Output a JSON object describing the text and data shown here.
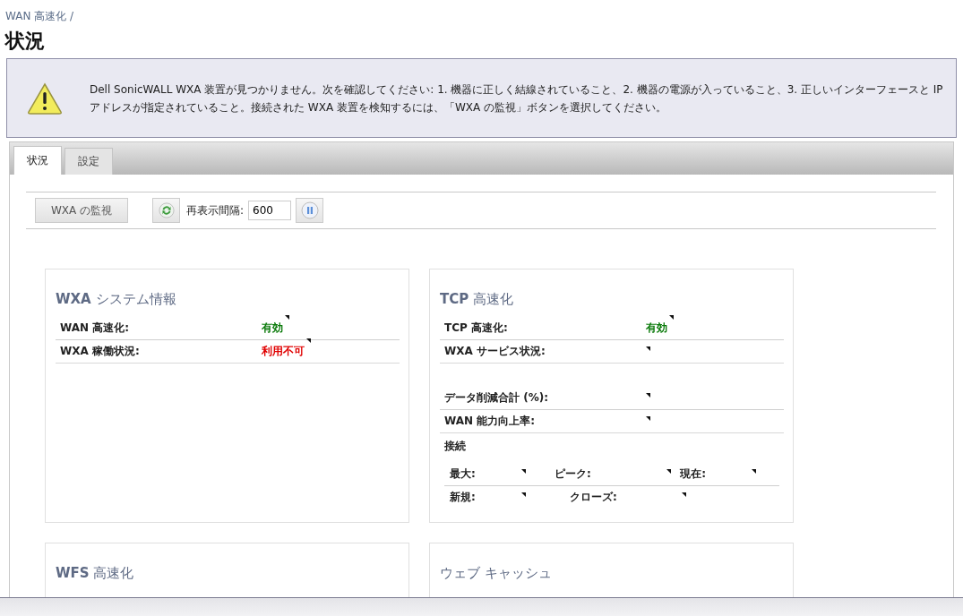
{
  "breadcrumb": "WAN 高速化 /",
  "page_title": "状況",
  "notice": {
    "text": "Dell SonicWALL WXA 装置が見つかりません。次を確認してください: 1. 機器に正しく結線されていること、2. 機器の電源が入っていること、3. 正しいインターフェースと IP アドレスが指定されていること。接続された WXA 装置を検知するには、「WXA の監視」ボタンを選択してください。"
  },
  "tabs": [
    {
      "label": "状況",
      "selected": true
    },
    {
      "label": "設定",
      "selected": false
    }
  ],
  "toolbar": {
    "monitor_button": "WXA の監視",
    "refresh_label": "再表示間隔:",
    "refresh_value": "600"
  },
  "panels": [
    {
      "title": "**WXA** システム情報",
      "groups": [
        [
          {
            "label": "WAN 高速化:",
            "value": "有効",
            "color": "#0a7a0a"
          },
          {
            "label": "WXA 稼働状況:",
            "value": "利用不可",
            "color": "#e00000"
          }
        ]
      ]
    },
    {
      "title": "**TCP** 高速化",
      "groups": [
        [
          {
            "label": "TCP 高速化:",
            "value": "有効",
            "color": "#0a7a0a"
          },
          {
            "label": "WXA サービス状況:"
          }
        ],
        [
          {
            "label": "データ削減合計 (%):"
          },
          {
            "label": "WAN 能力向上率:"
          }
        ]
      ],
      "connections": {
        "title": "接続",
        "rows": [
          [
            {
              "label": "最大:"
            },
            {
              "label": "ピーク:"
            },
            {
              "label": "現在:"
            }
          ],
          [
            {
              "label": "新規:"
            },
            {
              "label": "クローズ:"
            }
          ]
        ]
      }
    },
    {
      "title": "**WFS** 高速化"
    },
    {
      "title": "ウェブ キャッシュ"
    }
  ]
}
